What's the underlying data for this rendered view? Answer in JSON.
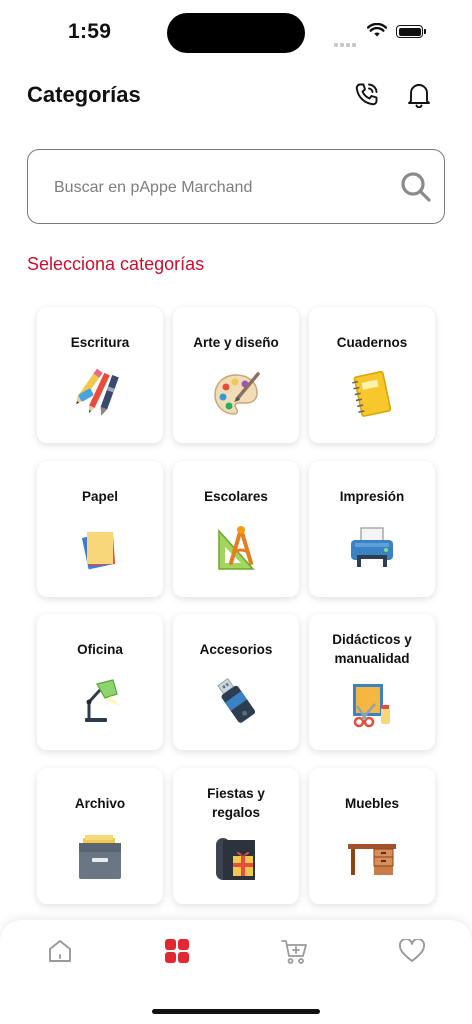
{
  "status": {
    "time": "1:59"
  },
  "header": {
    "title": "Categorías",
    "icons": [
      "phone-icon",
      "bell-icon"
    ]
  },
  "search": {
    "placeholder": "Buscar en pAppe Marchand",
    "icon": "search-icon"
  },
  "section": {
    "label": "Selecciona categorías"
  },
  "categories": [
    {
      "label": "Escritura",
      "icon": "pencils-icon"
    },
    {
      "label": "Arte y diseño",
      "icon": "palette-icon"
    },
    {
      "label": "Cuadernos",
      "icon": "notebook-icon"
    },
    {
      "label": "Papel",
      "icon": "paper-icon"
    },
    {
      "label": "Escolares",
      "icon": "ruler-compass-icon"
    },
    {
      "label": "Impresión",
      "icon": "printer-icon"
    },
    {
      "label": "Oficina",
      "icon": "desk-lamp-icon"
    },
    {
      "label": "Accesorios",
      "icon": "usb-drive-icon"
    },
    {
      "label": "Didácticos y\nmanualidad",
      "icon": "crafts-icon"
    },
    {
      "label": "Archivo",
      "icon": "file-cabinet-icon"
    },
    {
      "label": "Fiestas y\nregalos",
      "icon": "gift-wrap-icon"
    },
    {
      "label": "Muebles",
      "icon": "desk-icon"
    }
  ],
  "tabbar": {
    "tabs": [
      "home-icon",
      "categories-icon",
      "cart-icon",
      "heart-icon"
    ],
    "active": "categories-icon",
    "active_color": "#e3262f",
    "inactive_color": "#9a9a9a"
  },
  "colors": {
    "accent": "#c8102e"
  }
}
